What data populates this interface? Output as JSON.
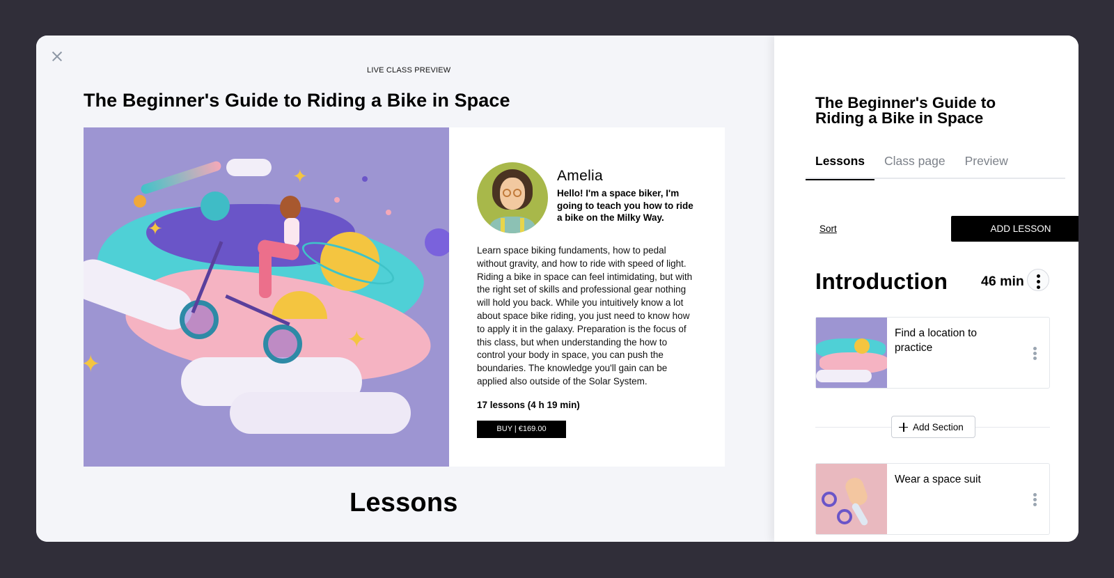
{
  "preview": {
    "label": "LIVE CLASS PREVIEW",
    "title": "The Beginner's Guide to Riding a Bike in Space",
    "hero_image": "space-bike-illustration",
    "instructor": {
      "name": "Amelia",
      "bio": "Hello! I'm a space biker, I'm going to teach you how to ride a bike on the Milky Way.",
      "avatar": "instructor-avatar"
    },
    "description": "Learn space biking fundaments, how to pedal without gravity, and how to ride with speed of light. Riding a bike in space can feel intimidating, but with the right set of skills and professional gear nothing will hold you back. While you intuitively know a lot about space bike riding, you just need to know how to apply it in the galaxy. Preparation is the focus of this class, but when understanding the how to control your body in space, you can push the boundaries. The knowledge you'll gain can be applied also outside of the Solar System.",
    "lesson_count": "17 lessons (4 h 19 min)",
    "buy_label": "BUY | €169.00",
    "lessons_heading": "Lessons"
  },
  "editor": {
    "title": "The Beginner's Guide to Riding a Bike in Space",
    "tabs": [
      {
        "label": "Lessons",
        "active": true
      },
      {
        "label": "Class page",
        "active": false
      },
      {
        "label": "Preview",
        "active": false
      }
    ],
    "sort_label": "Sort",
    "add_lesson_label": "ADD LESSON",
    "section": {
      "title": "Introduction",
      "duration": "46 min"
    },
    "lessons": [
      {
        "title": "Find a location to practice",
        "thumbnail": "space-bike-thumbnail"
      },
      {
        "title": "Wear a space suit",
        "thumbnail": "jumping-biker-thumbnail"
      }
    ],
    "add_section_label": "Add Section"
  },
  "colors": {
    "backdrop": "#302e39",
    "panel": "#f4f5f9",
    "hero_purple": "#9d95d2",
    "accent_black": "#000000",
    "thumb_pink": "#e9b9bf"
  }
}
